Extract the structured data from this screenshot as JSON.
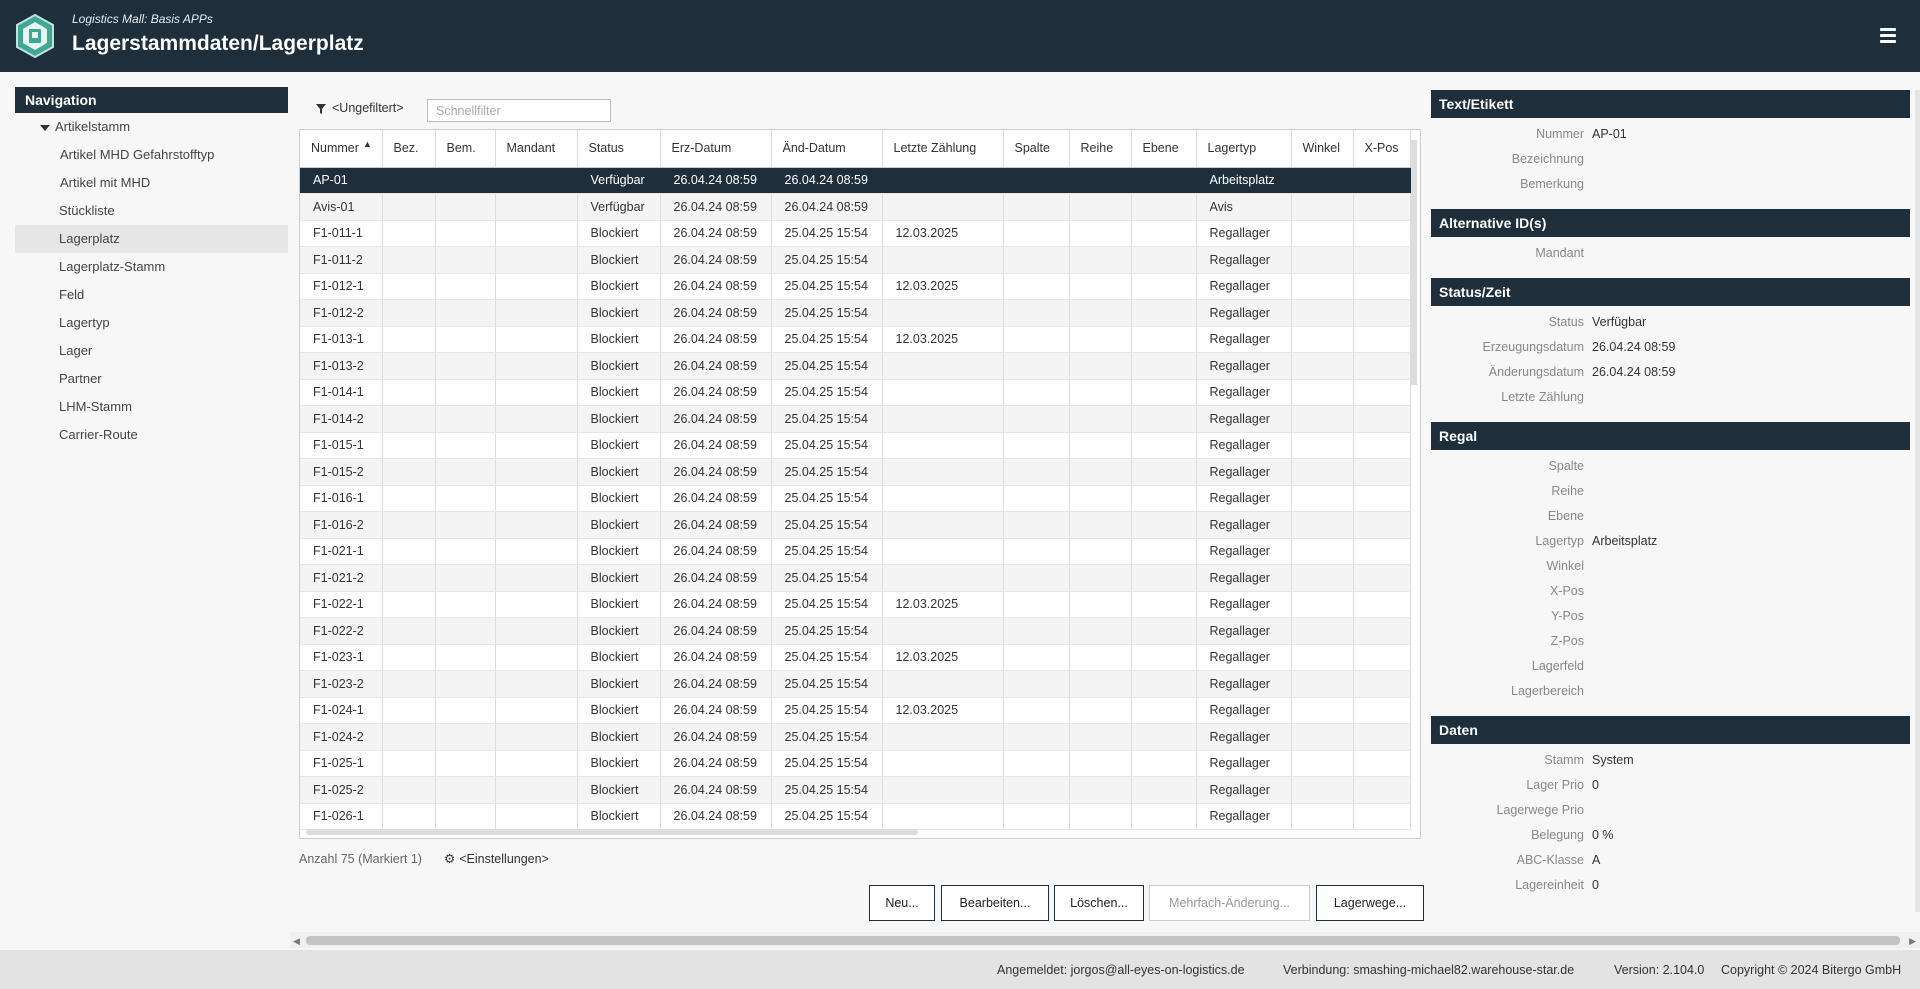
{
  "header": {
    "subtitle": "Logistics Mall: Basis APPs",
    "title": "Lagerstammdaten/Lagerplatz"
  },
  "colors": {
    "header_bg": "#1e2e3a",
    "selected_row_bg": "#1e2e3a",
    "logo_accent": "#3fa796"
  },
  "nav": {
    "title": "Navigation",
    "items": [
      {
        "label": "Artikelstamm",
        "level": 0,
        "expanded": true
      },
      {
        "label": "Artikel MHD Gefahrstofftyp",
        "level": 1
      },
      {
        "label": "Artikel mit MHD",
        "level": 1
      },
      {
        "label": "Stückliste",
        "level": 2
      },
      {
        "label": "Lagerplatz",
        "level": 2,
        "active": true
      },
      {
        "label": "Lagerplatz-Stamm",
        "level": 2
      },
      {
        "label": "Feld",
        "level": 2
      },
      {
        "label": "Lagertyp",
        "level": 2
      },
      {
        "label": "Lager",
        "level": 2
      },
      {
        "label": "Partner",
        "level": 2
      },
      {
        "label": "LHM-Stamm",
        "level": 2
      },
      {
        "label": "Carrier-Route",
        "level": 2
      }
    ]
  },
  "filter": {
    "icon": "filter-icon",
    "label": "<Ungefiltert>",
    "quick_filter_placeholder": "Schnellfilter",
    "quick_filter_value": ""
  },
  "table": {
    "sort_column": "Nummer",
    "sort_direction": "ascending",
    "columns": [
      "Nummer",
      "Bez.",
      "Bem.",
      "Mandant",
      "Status",
      "Erz-Datum",
      "Änd-Datum",
      "Letzte Zählung",
      "Spalte",
      "Reihe",
      "Ebene",
      "Lagertyp",
      "Winkel",
      "X-Pos"
    ],
    "rows": [
      [
        "AP-01",
        "",
        "",
        "",
        "Verfügbar",
        "26.04.24 08:59",
        "26.04.24 08:59",
        "",
        "",
        "",
        "",
        "Arbeitsplatz",
        "",
        ""
      ],
      [
        "Avis-01",
        "",
        "",
        "",
        "Verfügbar",
        "26.04.24 08:59",
        "26.04.24 08:59",
        "",
        "",
        "",
        "",
        "Avis",
        "",
        ""
      ],
      [
        "F1-011-1",
        "",
        "",
        "",
        "Blockiert",
        "26.04.24 08:59",
        "25.04.25 15:54",
        "12.03.2025",
        "",
        "",
        "",
        "Regallager",
        "",
        ""
      ],
      [
        "F1-011-2",
        "",
        "",
        "",
        "Blockiert",
        "26.04.24 08:59",
        "25.04.25 15:54",
        "",
        "",
        "",
        "",
        "Regallager",
        "",
        ""
      ],
      [
        "F1-012-1",
        "",
        "",
        "",
        "Blockiert",
        "26.04.24 08:59",
        "25.04.25 15:54",
        "12.03.2025",
        "",
        "",
        "",
        "Regallager",
        "",
        ""
      ],
      [
        "F1-012-2",
        "",
        "",
        "",
        "Blockiert",
        "26.04.24 08:59",
        "25.04.25 15:54",
        "",
        "",
        "",
        "",
        "Regallager",
        "",
        ""
      ],
      [
        "F1-013-1",
        "",
        "",
        "",
        "Blockiert",
        "26.04.24 08:59",
        "25.04.25 15:54",
        "12.03.2025",
        "",
        "",
        "",
        "Regallager",
        "",
        ""
      ],
      [
        "F1-013-2",
        "",
        "",
        "",
        "Blockiert",
        "26.04.24 08:59",
        "25.04.25 15:54",
        "",
        "",
        "",
        "",
        "Regallager",
        "",
        ""
      ],
      [
        "F1-014-1",
        "",
        "",
        "",
        "Blockiert",
        "26.04.24 08:59",
        "25.04.25 15:54",
        "",
        "",
        "",
        "",
        "Regallager",
        "",
        ""
      ],
      [
        "F1-014-2",
        "",
        "",
        "",
        "Blockiert",
        "26.04.24 08:59",
        "25.04.25 15:54",
        "",
        "",
        "",
        "",
        "Regallager",
        "",
        ""
      ],
      [
        "F1-015-1",
        "",
        "",
        "",
        "Blockiert",
        "26.04.24 08:59",
        "25.04.25 15:54",
        "",
        "",
        "",
        "",
        "Regallager",
        "",
        ""
      ],
      [
        "F1-015-2",
        "",
        "",
        "",
        "Blockiert",
        "26.04.24 08:59",
        "25.04.25 15:54",
        "",
        "",
        "",
        "",
        "Regallager",
        "",
        ""
      ],
      [
        "F1-016-1",
        "",
        "",
        "",
        "Blockiert",
        "26.04.24 08:59",
        "25.04.25 15:54",
        "",
        "",
        "",
        "",
        "Regallager",
        "",
        ""
      ],
      [
        "F1-016-2",
        "",
        "",
        "",
        "Blockiert",
        "26.04.24 08:59",
        "25.04.25 15:54",
        "",
        "",
        "",
        "",
        "Regallager",
        "",
        ""
      ],
      [
        "F1-021-1",
        "",
        "",
        "",
        "Blockiert",
        "26.04.24 08:59",
        "25.04.25 15:54",
        "",
        "",
        "",
        "",
        "Regallager",
        "",
        ""
      ],
      [
        "F1-021-2",
        "",
        "",
        "",
        "Blockiert",
        "26.04.24 08:59",
        "25.04.25 15:54",
        "",
        "",
        "",
        "",
        "Regallager",
        "",
        ""
      ],
      [
        "F1-022-1",
        "",
        "",
        "",
        "Blockiert",
        "26.04.24 08:59",
        "25.04.25 15:54",
        "12.03.2025",
        "",
        "",
        "",
        "Regallager",
        "",
        ""
      ],
      [
        "F1-022-2",
        "",
        "",
        "",
        "Blockiert",
        "26.04.24 08:59",
        "25.04.25 15:54",
        "",
        "",
        "",
        "",
        "Regallager",
        "",
        ""
      ],
      [
        "F1-023-1",
        "",
        "",
        "",
        "Blockiert",
        "26.04.24 08:59",
        "25.04.25 15:54",
        "12.03.2025",
        "",
        "",
        "",
        "Regallager",
        "",
        ""
      ],
      [
        "F1-023-2",
        "",
        "",
        "",
        "Blockiert",
        "26.04.24 08:59",
        "25.04.25 15:54",
        "",
        "",
        "",
        "",
        "Regallager",
        "",
        ""
      ],
      [
        "F1-024-1",
        "",
        "",
        "",
        "Blockiert",
        "26.04.24 08:59",
        "25.04.25 15:54",
        "12.03.2025",
        "",
        "",
        "",
        "Regallager",
        "",
        ""
      ],
      [
        "F1-024-2",
        "",
        "",
        "",
        "Blockiert",
        "26.04.24 08:59",
        "25.04.25 15:54",
        "",
        "",
        "",
        "",
        "Regallager",
        "",
        ""
      ],
      [
        "F1-025-1",
        "",
        "",
        "",
        "Blockiert",
        "26.04.24 08:59",
        "25.04.25 15:54",
        "",
        "",
        "",
        "",
        "Regallager",
        "",
        ""
      ],
      [
        "F1-025-2",
        "",
        "",
        "",
        "Blockiert",
        "26.04.24 08:59",
        "25.04.25 15:54",
        "",
        "",
        "",
        "",
        "Regallager",
        "",
        ""
      ],
      [
        "F1-026-1",
        "",
        "",
        "",
        "Blockiert",
        "26.04.24 08:59",
        "25.04.25 15:54",
        "",
        "",
        "",
        "",
        "Regallager",
        "",
        ""
      ]
    ],
    "selected_row": 0
  },
  "table_footer": {
    "count_text": "Anzahl 75 (Markiert 1)",
    "settings_label": "<Einstellungen>",
    "settings_icon": "gear-icon"
  },
  "buttons": {
    "new": "Neu...",
    "edit": "Bearbeiten...",
    "delete": "Löschen...",
    "multi_edit": "Mehrfach-Änderung...",
    "storage_paths": "Lagerwege..."
  },
  "detail": {
    "sections": [
      {
        "title": "Text/Etikett",
        "fields": [
          {
            "label": "Nummer",
            "value": "AP-01"
          },
          {
            "label": "Bezeichnung",
            "value": ""
          },
          {
            "label": "Bemerkung",
            "value": ""
          }
        ]
      },
      {
        "title": "Alternative ID(s)",
        "fields": [
          {
            "label": "Mandant",
            "value": ""
          }
        ]
      },
      {
        "title": "Status/Zeit",
        "fields": [
          {
            "label": "Status",
            "value": "Verfügbar"
          },
          {
            "label": "Erzeugungsdatum",
            "value": "26.04.24 08:59"
          },
          {
            "label": "Änderungsdatum",
            "value": "26.04.24 08:59"
          },
          {
            "label": "Letzte Zählung",
            "value": ""
          }
        ]
      },
      {
        "title": "Regal",
        "fields": [
          {
            "label": "Spalte",
            "value": ""
          },
          {
            "label": "Reihe",
            "value": ""
          },
          {
            "label": "Ebene",
            "value": ""
          },
          {
            "label": "Lagertyp",
            "value": "Arbeitsplatz"
          },
          {
            "label": "Winkel",
            "value": ""
          },
          {
            "label": "X-Pos",
            "value": ""
          },
          {
            "label": "Y-Pos",
            "value": ""
          },
          {
            "label": "Z-Pos",
            "value": ""
          },
          {
            "label": "Lagerfeld",
            "value": ""
          },
          {
            "label": "Lagerbereich",
            "value": ""
          }
        ]
      },
      {
        "title": "Daten",
        "fields": [
          {
            "label": "Stamm",
            "value": "System"
          },
          {
            "label": "Lager Prio",
            "value": "0"
          },
          {
            "label": "Lagerwege Prio",
            "value": ""
          },
          {
            "label": "Belegung",
            "value": "0 %"
          },
          {
            "label": "ABC-Klasse",
            "value": "A"
          },
          {
            "label": "Lagereinheit",
            "value": "0"
          }
        ]
      }
    ]
  },
  "footer": {
    "user": "Angemeldet: jorgos@all-eyes-on-logistics.de",
    "connection": "Verbindung: smashing-michael82.warehouse-star.de",
    "version": "Version: 2.104.0",
    "copyright": "Copyright © 2024 Bitergo GmbH"
  }
}
